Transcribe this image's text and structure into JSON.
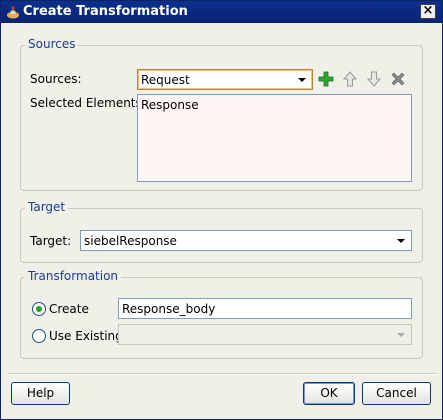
{
  "window": {
    "title": "Create Transformation",
    "close_label": "×"
  },
  "sources_group": {
    "title": "Sources",
    "sources_label": "Sources:",
    "sources_value": "Request",
    "selected_label": "Selected Elements:",
    "selected_items": [
      "Response"
    ],
    "tools": [
      "add-icon",
      "move-up-icon",
      "move-down-icon",
      "delete-icon"
    ]
  },
  "target_group": {
    "title": "Target",
    "target_label": "Target:",
    "target_value": "siebelResponse"
  },
  "transformation_group": {
    "title": "Transformation",
    "create_label": "Create",
    "create_value": "Response_body",
    "create_selected": true,
    "use_existing_label": "Use Existing",
    "use_existing_value": ""
  },
  "buttons": {
    "help": "Help",
    "ok": "OK",
    "cancel": "Cancel"
  }
}
